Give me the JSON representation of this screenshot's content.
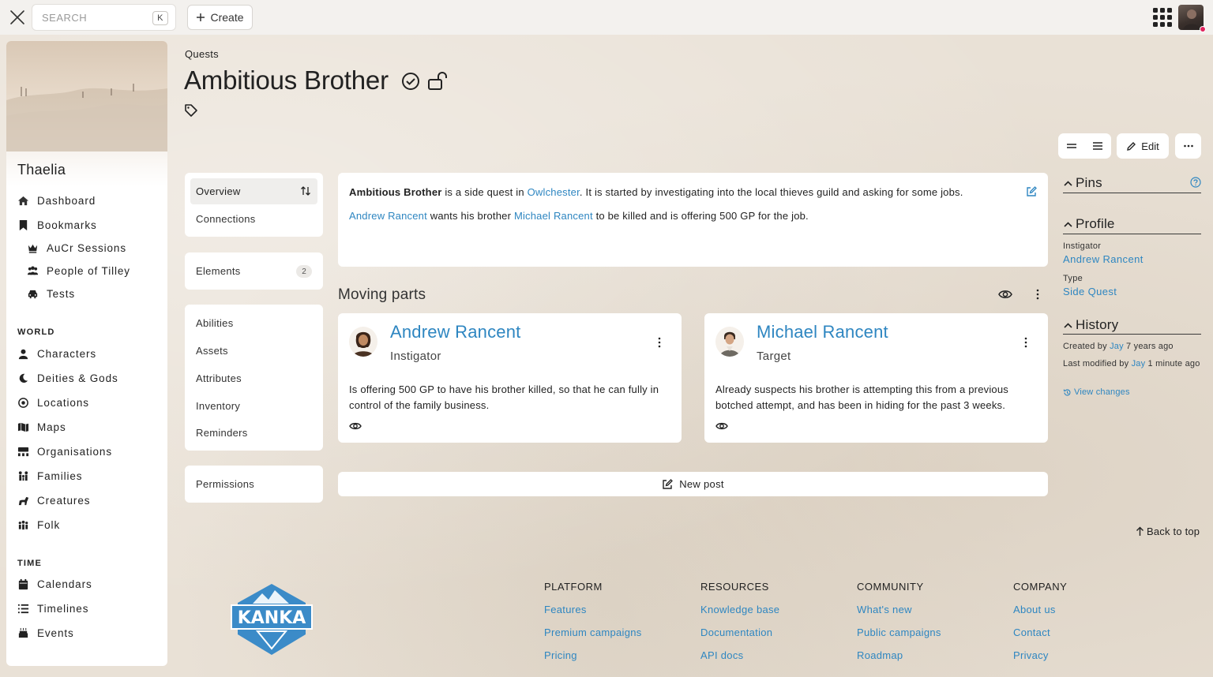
{
  "topbar": {
    "search_placeholder": "SEARCH",
    "search_shortcut": "K",
    "create_label": "Create"
  },
  "sidebar": {
    "campaign_name": "Thaelia",
    "items": [
      {
        "label": "Dashboard",
        "icon": "home-icon"
      },
      {
        "label": "Bookmarks",
        "icon": "bookmark-icon"
      },
      {
        "label": "AuCr Sessions",
        "icon": "crown-icon"
      },
      {
        "label": "People of Tilley",
        "icon": "users-icon"
      },
      {
        "label": "Tests",
        "icon": "car-icon"
      }
    ],
    "world_label": "WORLD",
    "world_items": [
      {
        "label": "Characters",
        "icon": "user-icon"
      },
      {
        "label": "Deities & Gods",
        "icon": "moon-icon"
      },
      {
        "label": "Locations",
        "icon": "location-icon"
      },
      {
        "label": "Maps",
        "icon": "map-icon"
      },
      {
        "label": "Organisations",
        "icon": "org-icon"
      },
      {
        "label": "Families",
        "icon": "family-icon"
      },
      {
        "label": "Creatures",
        "icon": "creature-icon"
      },
      {
        "label": "Folk",
        "icon": "folk-icon"
      }
    ],
    "time_label": "TIME",
    "time_items": [
      {
        "label": "Calendars",
        "icon": "calendar-icon"
      },
      {
        "label": "Timelines",
        "icon": "timeline-icon"
      },
      {
        "label": "Events",
        "icon": "event-icon"
      }
    ]
  },
  "header": {
    "breadcrumb": "Quests",
    "title": "Ambitious Brother"
  },
  "toolbar": {
    "edit_label": "Edit"
  },
  "subnav": {
    "overview": "Overview",
    "connections": "Connections",
    "elements": "Elements",
    "elements_count": "2",
    "abilities": "Abilities",
    "assets": "Assets",
    "attributes": "Attributes",
    "inventory": "Inventory",
    "reminders": "Reminders",
    "permissions": "Permissions"
  },
  "entry": {
    "line1_bold": "Ambitious Brother",
    "line1_a": " is a side quest in ",
    "line1_link": "Owlchester",
    "line1_b": ". It is started by investigating into the local thieves guild and asking for some jobs.",
    "line2_link1": "Andrew Rancent",
    "line2_a": " wants his brother ",
    "line2_link2": "Michael Rancent",
    "line2_b": " to be killed and is offering 500 GP for the job."
  },
  "moving_parts": {
    "title": "Moving parts",
    "members": [
      {
        "name": "Andrew Rancent",
        "role": "Instigator",
        "description": "Is offering 500 GP to have his brother killed, so that he can fully in control of the family business."
      },
      {
        "name": "Michael Rancent",
        "role": "Target",
        "description": "Already suspects his brother is attempting this from a previous botched attempt, and has been in hiding for the past 3 weeks."
      }
    ],
    "new_post_label": "New post"
  },
  "panel": {
    "pins_title": "Pins",
    "profile_title": "Profile",
    "instigator_label": "Instigator",
    "instigator_value": "Andrew Rancent",
    "type_label": "Type",
    "type_value": "Side Quest",
    "history_title": "History",
    "created_prefix": "Created by ",
    "created_user": "Jay",
    "created_suffix": " 7 years ago",
    "modified_prefix": "Last modified by ",
    "modified_user": "Jay",
    "modified_suffix": " 1 minute ago",
    "view_changes": "View changes"
  },
  "back_to_top": "Back to top",
  "footer": {
    "logo_text": "KANKA",
    "columns": [
      {
        "title": "PLATFORM",
        "links": [
          "Features",
          "Premium campaigns",
          "Pricing"
        ]
      },
      {
        "title": "RESOURCES",
        "links": [
          "Knowledge base",
          "Documentation",
          "API docs"
        ]
      },
      {
        "title": "COMMUNITY",
        "links": [
          "What's new",
          "Public campaigns",
          "Roadmap"
        ]
      },
      {
        "title": "COMPANY",
        "links": [
          "About us",
          "Contact",
          "Privacy"
        ]
      }
    ]
  },
  "colors": {
    "link": "#2e86c1",
    "accent_dot": "#e0245e",
    "logo_blue": "#3b8bc8"
  }
}
